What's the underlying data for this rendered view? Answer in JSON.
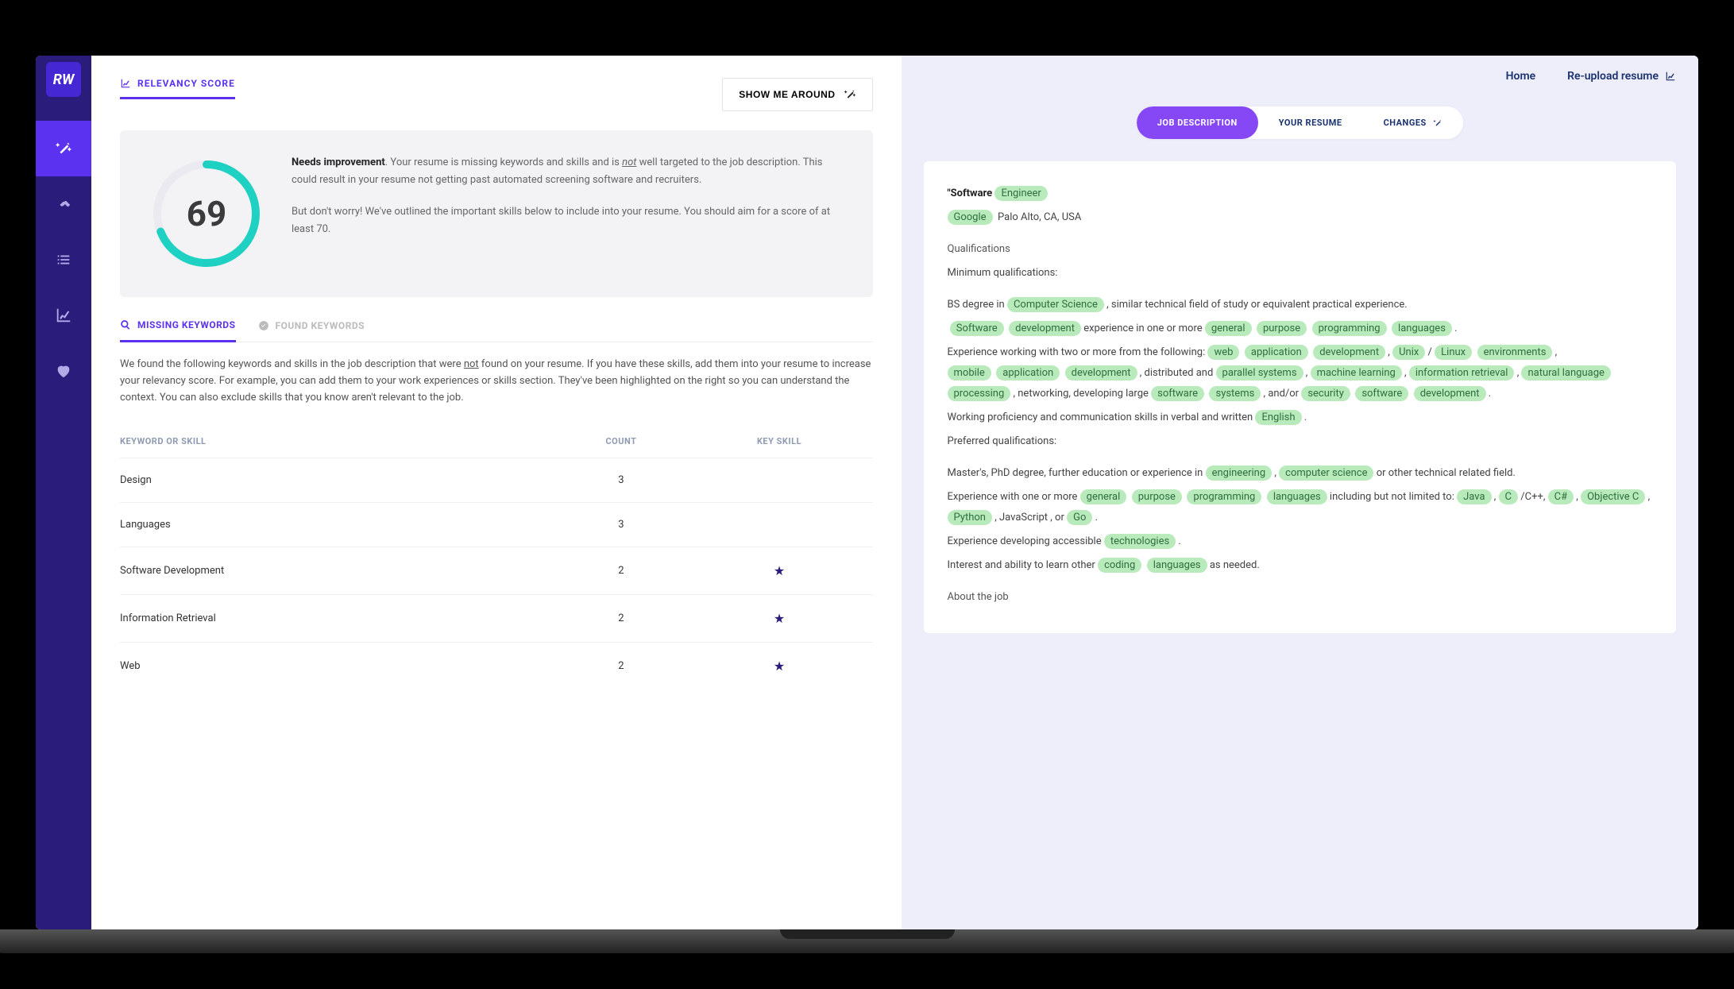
{
  "brand": "RW",
  "pageTitle": "RELEVANCY SCORE",
  "showMeAround": "SHOW ME AROUND",
  "score": {
    "value": "69",
    "needs": "Needs improvement",
    "p1_rest": ". Your resume is missing keywords and skills and is ",
    "not": "not",
    "p1_tail": " well targeted to the job description. This could result in your resume not getting past automated screening software and recruiters.",
    "p2": "But don't worry! We've outlined the important skills below to include into your resume. You should aim for a score of at least 70."
  },
  "ktabs": {
    "missing": "MISSING KEYWORDS",
    "found": "FOUND KEYWORDS"
  },
  "desc_a": "We found the following keywords and skills in the job description that were ",
  "desc_not": "not",
  "desc_b": " found on your resume. If you have these skills, add them into your resume to increase your relevancy score. For example, you can add them to your work experiences or skills section. They've been highlighted on the right so you can understand the context. You can also exclude skills that you know aren't relevant to the job.",
  "headers": {
    "k": "KEYWORD OR SKILL",
    "c": "COUNT",
    "ks": "KEY SKILL"
  },
  "rows": [
    {
      "k": "Design",
      "c": "3",
      "star": false
    },
    {
      "k": "Languages",
      "c": "3",
      "star": false
    },
    {
      "k": "Software Development",
      "c": "2",
      "star": true
    },
    {
      "k": "Information Retrieval",
      "c": "2",
      "star": true
    },
    {
      "k": "Web",
      "c": "2",
      "star": true
    }
  ],
  "topLinks": {
    "home": "Home",
    "reupload": "Re-upload resume"
  },
  "segments": {
    "jd": "JOB DESCRIPTION",
    "yr": "YOUR RESUME",
    "ch": "CHANGES"
  },
  "jd": {
    "titlePrefix": "\"Software ",
    "titleHl": "Engineer",
    "company": "Google",
    "loc": "Palo Alto, CA, USA",
    "qual": "Qualifications",
    "minq": "Minimum qualifications:",
    "bs1": "BS degree in ",
    "bs_hl": "Computer  Science",
    "bs2": " , similar technical field of study or equivalent practical experience.",
    "sw1": "Software",
    "sw2": "development",
    "sw_txt": " experience in one or more ",
    "sw3": "general",
    "sw4": "purpose",
    "sw5": "programming",
    "sw6": "languages",
    "dot": " .",
    "exp1": "Experience working with two or more from the following: ",
    "w1": "web",
    "w2": "application",
    "w3": "development",
    "comma": " , ",
    "u1": "Unix",
    "slash": " / ",
    "u2": "Linux",
    "u3": "environments",
    "m1": "mobile",
    "m2": "application",
    "m3": "development",
    "dp": " , distributed and ",
    "p1": "parallel  systems",
    "ml": "machine  learning",
    "ir": "information  retrieval",
    "nl": "natural  language",
    "pr": "processing",
    "net": " , networking, developing large ",
    "so": "software",
    "sy": "systems",
    "andor": " , and/or ",
    "sec": "security",
    "sd1": "software",
    "sd2": "development",
    "wp": "Working proficiency and communication skills in verbal and written ",
    "eng": "English",
    "pq": "Preferred qualifications:",
    "mp": "Master's, PhD degree, further education or experience in ",
    "engi": "engineering",
    "csci": "computer  science",
    "ortech": "or other technical related field.",
    "ewom": "Experience with one or more ",
    "g1": "general",
    "g2": "purpose",
    "g3": "programming",
    "g4": "languages",
    "incl": " including but not limited to: ",
    "java": "Java",
    "c": "C",
    "cpp": " /C++, ",
    "cs": "C#",
    "objc": "Objective  C",
    "py": "Python",
    "js": " , JavaScript ",
    "or": " , or ",
    "go": "Go",
    "eda": "Experience developing accessible ",
    "tech": "technologies",
    "intr": "Interest and ability to learn other ",
    "cod": "coding",
    "lan": "languages",
    "asn": " as needed.",
    "about": "About the job"
  }
}
